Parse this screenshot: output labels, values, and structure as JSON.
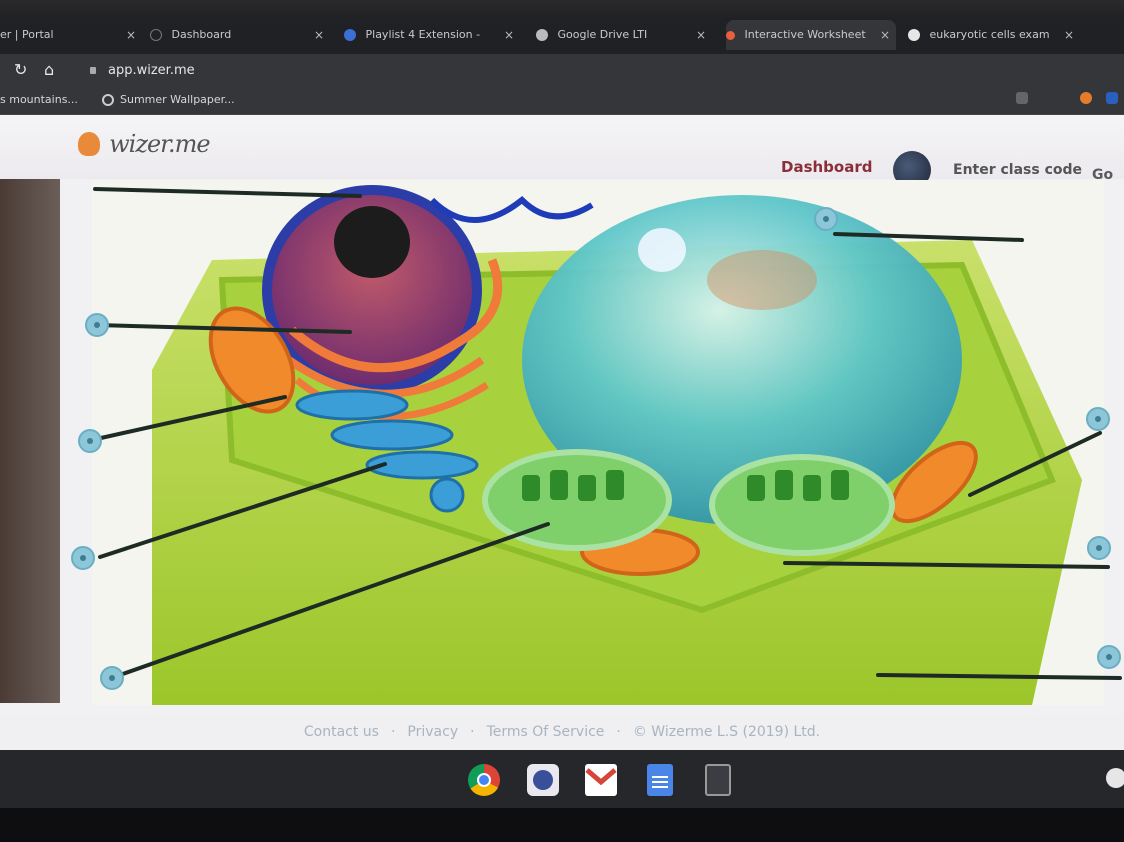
{
  "browser": {
    "tabs": [
      {
        "title": "er | Portal"
      },
      {
        "title": "Dashboard"
      },
      {
        "title": "Playlist 4 Extension -"
      },
      {
        "title": "Google Drive LTI"
      },
      {
        "title": "Interactive Worksheet"
      },
      {
        "title": "eukaryotic cells exam"
      }
    ],
    "close_glyph": "×",
    "new_tab_glyph": "+",
    "url": "app.wizer.me",
    "bookmarks": [
      {
        "label": "s mountains..."
      },
      {
        "label": "Summer Wallpaper..."
      }
    ],
    "colors": {
      "tabstrip": "#202124",
      "toolbar": "#35363a"
    }
  },
  "site": {
    "logo_text": "wizer.me",
    "nav_dashboard": "Dashboard",
    "class_code_placeholder": "Enter class code",
    "go_label": "Go",
    "brand_color": "#8a2f38"
  },
  "worksheet": {
    "label_points": 10
  },
  "footer": {
    "links": [
      "Contact us",
      "Privacy",
      "Terms Of Service"
    ],
    "separator": "·",
    "copyright": "© Wizerme L.S (2019) Ltd."
  },
  "shelf": {
    "apps": [
      "chrome-icon",
      "wizer-icon",
      "gmail-icon",
      "docs-icon",
      "calculator-icon"
    ]
  }
}
